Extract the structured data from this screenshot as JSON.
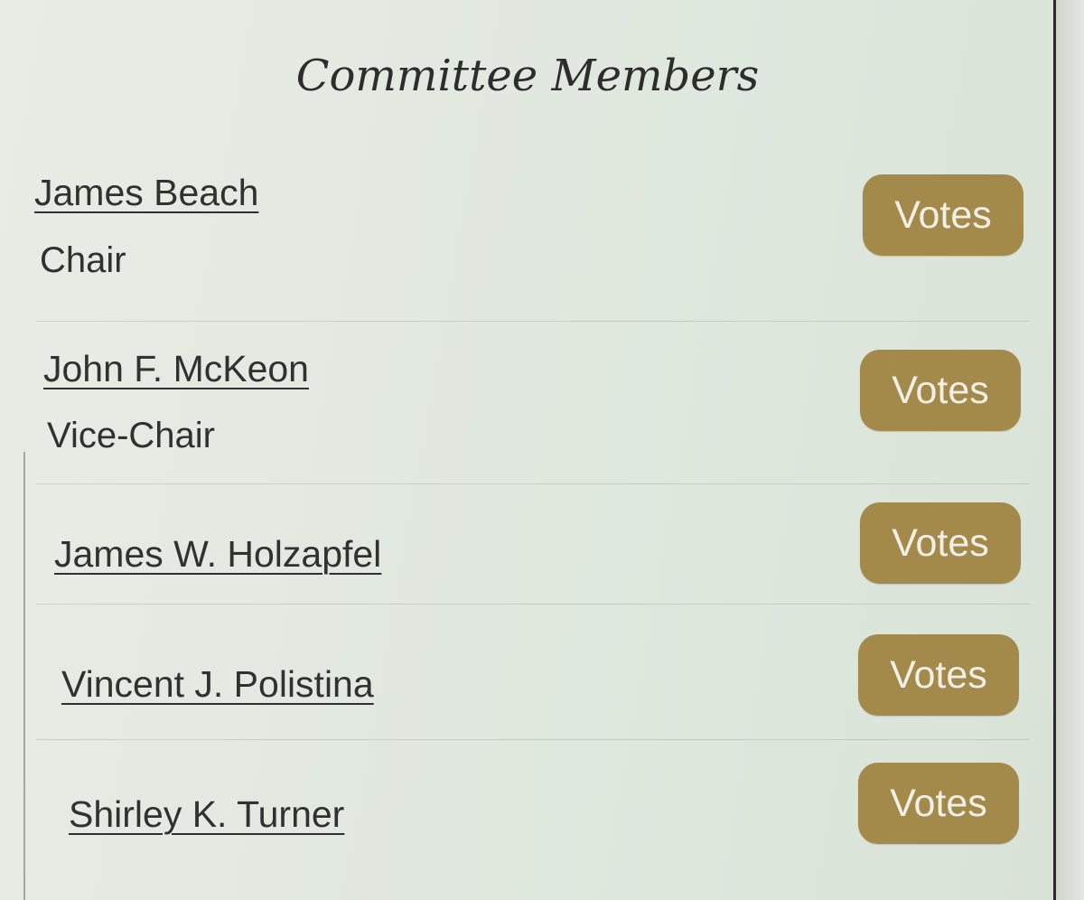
{
  "header": {
    "title": "Committee Members"
  },
  "members": [
    {
      "name": "James Beach",
      "role": "Chair",
      "button_label": "Votes"
    },
    {
      "name": "John F. McKeon",
      "role": "Vice-Chair",
      "button_label": "Votes"
    },
    {
      "name": "James W. Holzapfel",
      "role": "",
      "button_label": "Votes"
    },
    {
      "name": "Vincent J. Polistina",
      "role": "",
      "button_label": "Votes"
    },
    {
      "name": "Shirley K. Turner",
      "role": "",
      "button_label": "Votes"
    }
  ],
  "colors": {
    "button_bg": "#a48a4a",
    "button_text": "#f1efe6",
    "text": "#2f3230",
    "panel_bg": "#e3e9e1"
  }
}
